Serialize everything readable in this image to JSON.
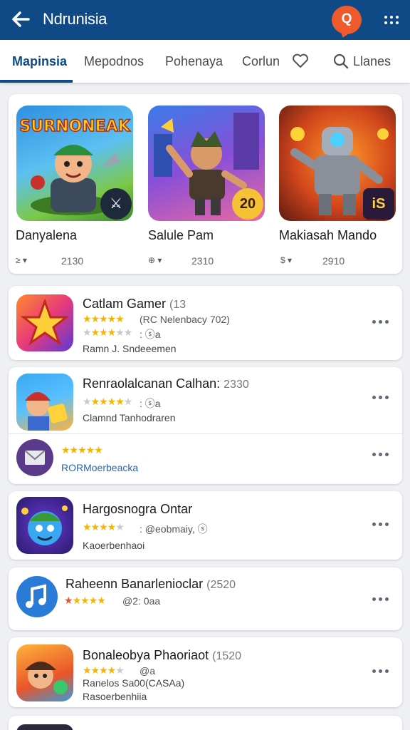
{
  "header": {
    "title": "Ndrunisia",
    "badge_icon": "question-chat-icon",
    "badge_glyph": "Q"
  },
  "tabs": [
    {
      "label": "Mapinsia",
      "active": true
    },
    {
      "label": "Mepodnos"
    },
    {
      "label": "Pohenaya"
    },
    {
      "label": "Corlun"
    },
    {
      "label": "Llanes"
    }
  ],
  "featured": [
    {
      "name": "Danyalena",
      "symbols": "≥ ▾",
      "meta": "2130",
      "art_text": "SURNONEAK",
      "badge": "⚔"
    },
    {
      "name": "Salule Pam",
      "symbols": "⊕ ▾",
      "meta": "2310",
      "badge": "20"
    },
    {
      "name": "Makiasah Mando",
      "symbols": "$ ▾",
      "meta": "2910",
      "badge": "iS"
    }
  ],
  "apps": [
    {
      "title": "Catlam Gamer",
      "num": "(13",
      "rating_note": "(RC Nelenbacy 702)",
      "line2": ": ⓢa",
      "sub": "Ramn J. Sndeeemen"
    },
    {
      "title": "Renraolalcanan Calhan:",
      "num": "2330",
      "rating_note": ": ⓢa",
      "sub": "Clamnd Tanhodraren"
    },
    {
      "title": "",
      "num": "",
      "rating_note": "",
      "sub": "RORMoerbeacka"
    },
    {
      "title": "Hargosnogra Ontar",
      "num": "",
      "rating_note": ": @eobmaiy, ⓢ",
      "sub": "Kaoerbenhaoi"
    },
    {
      "title": "Raheenn Banarlenioclar",
      "num": "(2520",
      "rating_note": "@2: 0aa",
      "sub": ""
    },
    {
      "title": "Bonaleobya Phaoriaot",
      "num": "(1520",
      "rating_note": "@a",
      "line2": "Ranelos Sa00(CASAa)",
      "sub": "Rasoerbenhiia"
    }
  ],
  "colors": {
    "brand": "#0f4a86",
    "accent": "#ef5a2c",
    "star": "#f4b400"
  }
}
